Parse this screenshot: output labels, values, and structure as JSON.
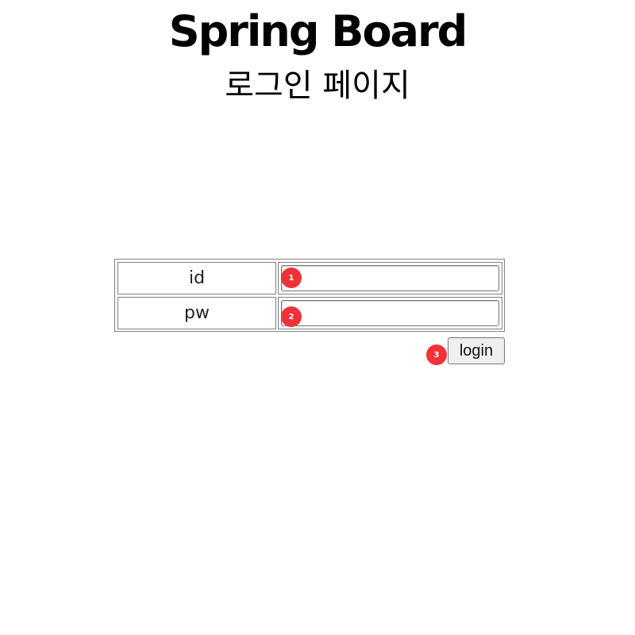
{
  "header": {
    "app_title": "Spring Board",
    "page_heading": "로그인 페이지"
  },
  "login_form": {
    "id_label": "id",
    "id_value": "",
    "pw_label": "pw",
    "pw_value": "",
    "login_button_label": "login"
  },
  "annotations": {
    "badge_1": "1",
    "badge_2": "2",
    "badge_3": "3",
    "badge_color": "#ee3338"
  }
}
